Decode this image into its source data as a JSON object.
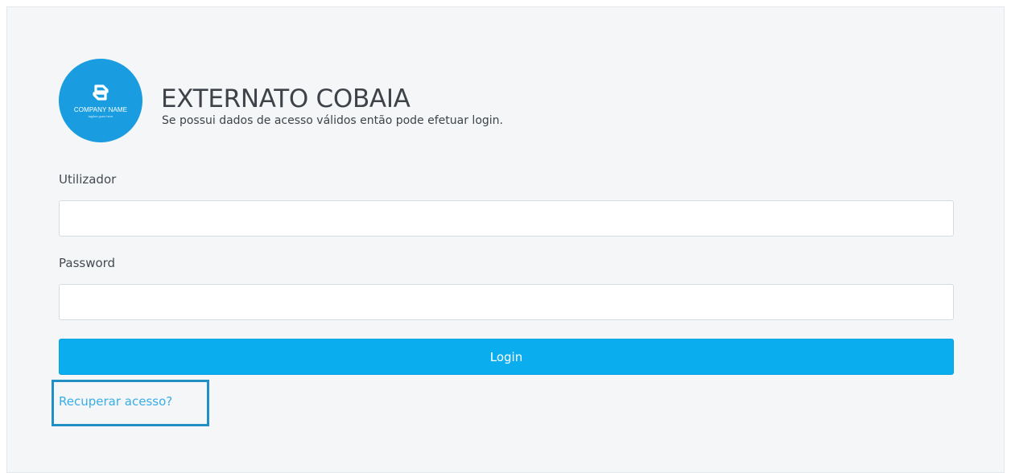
{
  "brand": {
    "logo_name": "COMPANY NAME",
    "logo_tagline": "tagline goes here",
    "logo_color": "#1a9de0"
  },
  "header": {
    "title": "EXTERNATO COBAIA",
    "subtitle": "Se possui dados de acesso válidos então pode efetuar login."
  },
  "form": {
    "username_label": "Utilizador",
    "username_value": "",
    "password_label": "Password",
    "password_value": "",
    "login_button": "Login",
    "recover_link": "Recuperar acesso?"
  },
  "colors": {
    "accent": "#0aaeef",
    "link": "#38aee6",
    "highlight_border": "#1f8fc4",
    "panel_background": "#f4f6f8"
  }
}
